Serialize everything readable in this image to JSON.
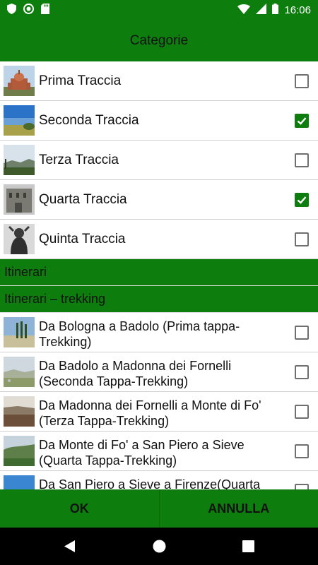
{
  "status_bar": {
    "time": "16:06"
  },
  "header": {
    "title": "Categorie"
  },
  "categories": [
    {
      "label": "Prima Traccia",
      "checked": false
    },
    {
      "label": "Seconda Traccia",
      "checked": true
    },
    {
      "label": "Terza Traccia",
      "checked": false
    },
    {
      "label": "Quarta Traccia",
      "checked": true
    },
    {
      "label": "Quinta Traccia",
      "checked": false
    }
  ],
  "sections": {
    "itinerari": "Itinerari",
    "trekking": "Itinerari – trekking"
  },
  "trekking_items": [
    {
      "label": "Da Bologna a Badolo (Prima tappa-Trekking)",
      "checked": false
    },
    {
      "label": "Da Badolo a Madonna dei Fornelli (Seconda Tappa-Trekking)",
      "checked": false
    },
    {
      "label": "Da Madonna dei Fornelli a Monte di Fo' (Terza Tappa-Trekking)",
      "checked": false
    },
    {
      "label": "Da Monte di Fo' a San Piero a Sieve (Quarta Tappa-Trekking)",
      "checked": false
    },
    {
      "label": "Da San Piero a Sieve a Firenze(Quarta",
      "checked": false
    }
  ],
  "footer": {
    "ok_label": "OK",
    "cancel_label": "ANNULLA"
  },
  "colors": {
    "primary_green": "#0d7e0d",
    "text": "#111111",
    "divider": "#cfcfcf"
  }
}
